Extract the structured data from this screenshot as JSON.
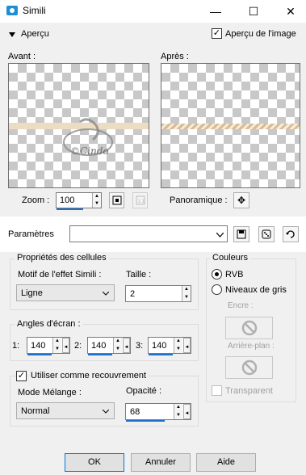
{
  "window": {
    "title": "Simili",
    "minimize": "—",
    "maximize": "☐",
    "close": "✕"
  },
  "preview": {
    "toggle_label": "Aperçu",
    "image_preview_label": "Aperçu de l'image",
    "image_preview_checked": true,
    "before_label": "Avant :",
    "after_label": "Après :",
    "zoom_label": "Zoom :",
    "zoom_value": "100",
    "pan_label": "Panoramique :"
  },
  "params": {
    "label": "Paramètres",
    "value": ""
  },
  "cells": {
    "group_title": "Propriétés des cellules",
    "motif_label": "Motif de l'effet Simili :",
    "motif_value": "Ligne",
    "size_label": "Taille :",
    "size_value": "2"
  },
  "angles": {
    "group_title": "Angles d'écran :",
    "a1_label": "1:",
    "a1_value": "140",
    "a2_label": "2:",
    "a2_value": "140",
    "a3_label": "3:",
    "a3_value": "140"
  },
  "overlay": {
    "checkbox_label": "Utiliser comme recouvrement",
    "checked": true,
    "blend_label": "Mode Mélange :",
    "blend_value": "Normal",
    "opacity_label": "Opacité :",
    "opacity_value": "68"
  },
  "colors": {
    "group_title": "Couleurs",
    "rgb_label": "RVB",
    "gray_label": "Niveaux de gris",
    "ink_label": "Encre :",
    "bg_label": "Arrière-plan :",
    "transparent_label": "Transparent"
  },
  "footer": {
    "ok": "OK",
    "cancel": "Annuler",
    "help": "Aide"
  },
  "accent": "#0078d7",
  "band_color": "#ebdcc2"
}
